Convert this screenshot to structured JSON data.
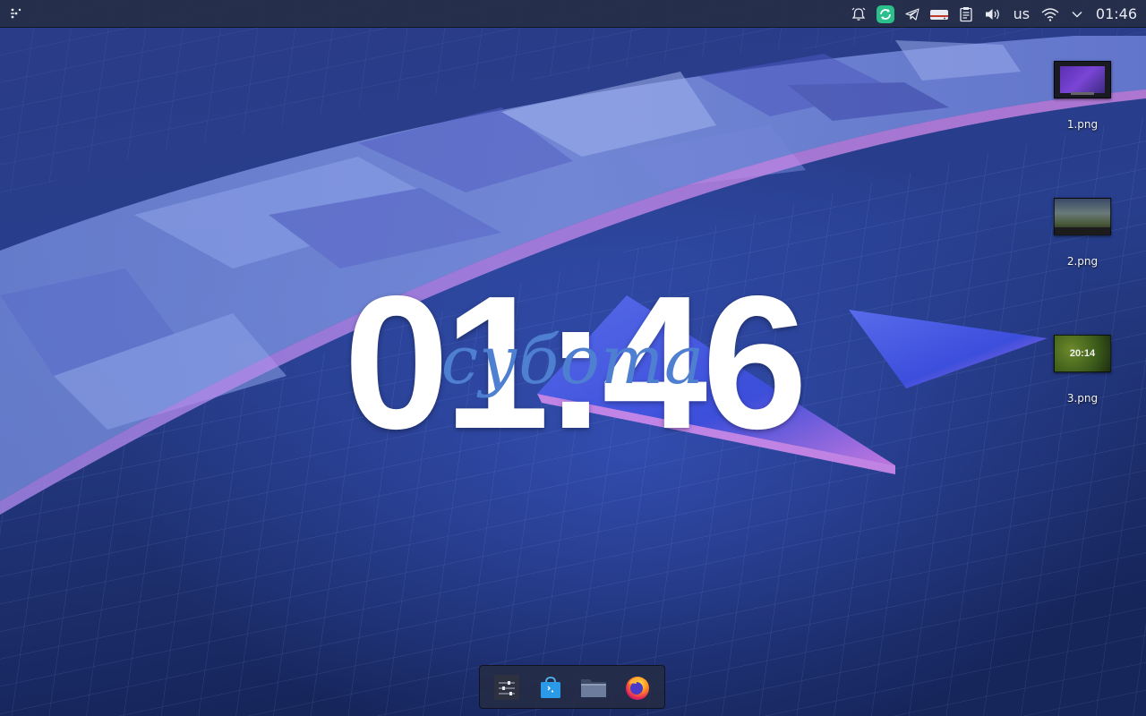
{
  "top_panel": {
    "tray": {
      "icons": [
        "notifications-icon",
        "app-status-icon",
        "telegram-icon",
        "drive-icon",
        "clipboard-icon",
        "volume-icon",
        "wifi-icon",
        "expand-tray-icon"
      ],
      "keyboard_layout": "us",
      "clock": "01:46"
    }
  },
  "desktop": {
    "icons": [
      {
        "label": "1.png"
      },
      {
        "label": "2.png"
      },
      {
        "label": "3.png",
        "thumb_text": "20:14"
      }
    ]
  },
  "clock_widget": {
    "time": "01:46",
    "day": "субота"
  },
  "dock": {
    "items": [
      "system-settings",
      "software-store",
      "file-manager",
      "firefox-browser"
    ]
  },
  "colors": {
    "panel": "#242c42",
    "accent_green": "#2bbf8c",
    "day_text": "#4f7fd0",
    "clock_text": "#ffffff"
  }
}
